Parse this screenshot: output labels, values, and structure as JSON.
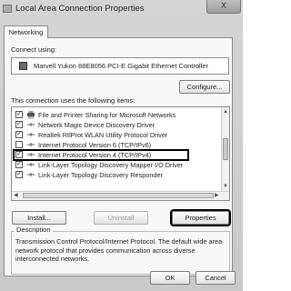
{
  "window": {
    "title": "Local Area Connection Properties",
    "close_label": "X"
  },
  "tabs": [
    {
      "label": "Networking",
      "selected": true
    }
  ],
  "connect_using": {
    "label": "Connect using:",
    "adapter": "Marvell Yukon 88E8056 PCI-E Gigabit Ethernet Controller",
    "configure_label": "Configure..."
  },
  "items_list": {
    "label": "This connection uses the following items:",
    "items": [
      {
        "label": "File and Printer Sharing for Microsoft Networks",
        "checked": true,
        "icon": "printer-icon"
      },
      {
        "label": "Network Magic Device Discovery Driver",
        "checked": true,
        "icon": "network-protocol-icon"
      },
      {
        "label": "Realtek RtlProt WLAN Utility Protocol Driver",
        "checked": true,
        "icon": "network-protocol-icon"
      },
      {
        "label": "Internet Protocol Version 6 (TCP/IPv6)",
        "checked": false,
        "icon": "network-protocol-icon"
      },
      {
        "label": "Internet Protocol Version 4 (TCP/IPv4)",
        "checked": true,
        "icon": "network-protocol-icon",
        "selected": true
      },
      {
        "label": "Link-Layer Topology Discovery Mapper I/O Driver",
        "checked": true,
        "icon": "network-protocol-icon"
      },
      {
        "label": "Link-Layer Topology Discovery Responder",
        "checked": true,
        "icon": "network-protocol-icon"
      }
    ]
  },
  "actions": {
    "install": "Install...",
    "uninstall": "Uninstall",
    "properties": "Properties"
  },
  "description": {
    "title": "Description",
    "text": "Transmission Control Protocol/Internet Protocol. The default wide area network protocol that provides communication across diverse interconnected networks."
  },
  "footer": {
    "ok": "OK",
    "cancel": "Cancel"
  },
  "colors": {
    "window_bg": "#cccccc",
    "panel_bg": "#f7f7f7",
    "highlight_border": "#000000"
  }
}
